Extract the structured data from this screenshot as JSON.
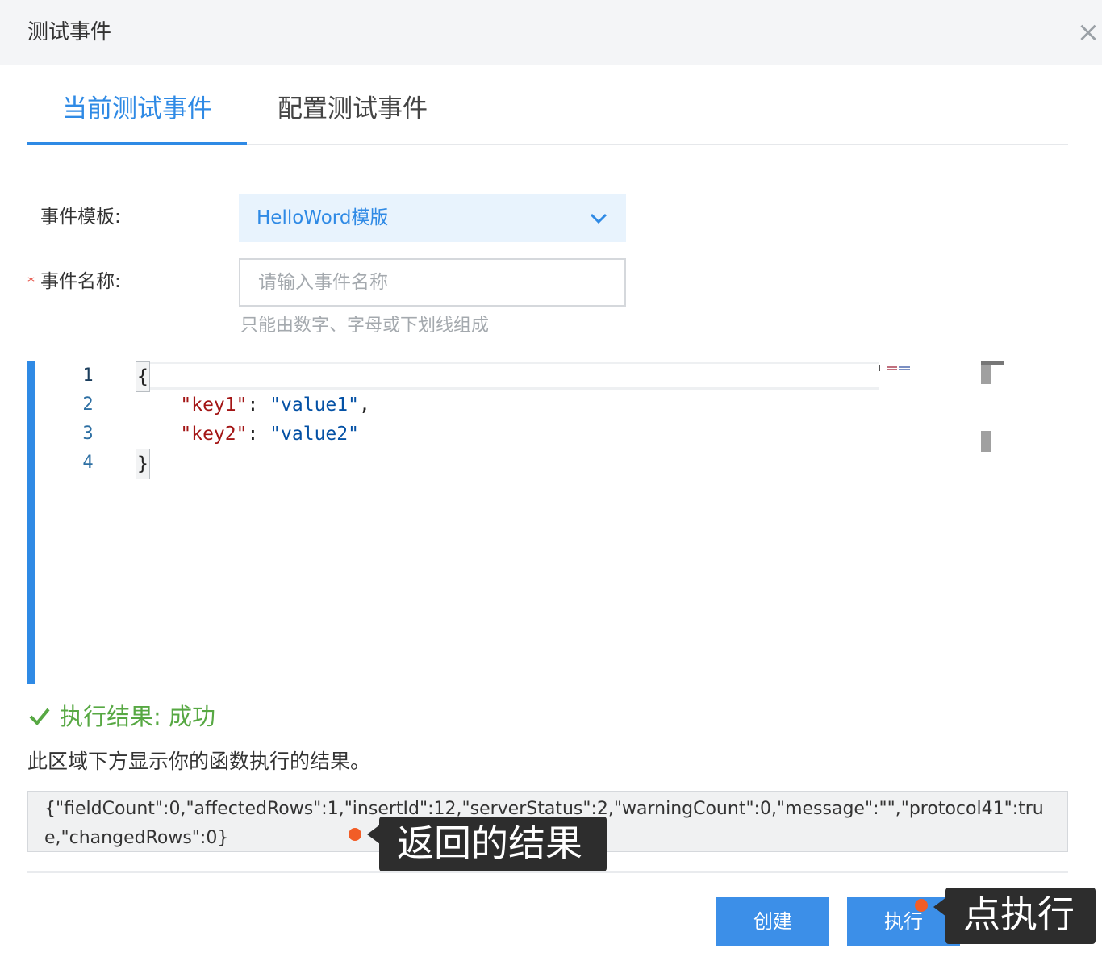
{
  "dialog": {
    "title": "测试事件",
    "close_glyph": "×"
  },
  "tabs": [
    {
      "label": "当前测试事件",
      "active": true
    },
    {
      "label": "配置测试事件",
      "active": false
    }
  ],
  "form": {
    "template_label": "事件模板:",
    "template_value": "HelloWord模版",
    "required_mark": "*",
    "name_label": "事件名称:",
    "name_placeholder": "请输入事件名称",
    "name_value": "",
    "name_hint": "只能由数字、字母或下划线组成"
  },
  "editor": {
    "line_numbers": [
      "1",
      "2",
      "3",
      "4"
    ],
    "lines": [
      {
        "text": "{"
      },
      {
        "indent": "    ",
        "key": "\"key1\"",
        "sep": ": ",
        "value": "\"value1\"",
        "tail": ","
      },
      {
        "indent": "    ",
        "key": "\"key2\"",
        "sep": ": ",
        "value": "\"value2\"",
        "tail": ""
      },
      {
        "text": "}"
      }
    ]
  },
  "result": {
    "status": "执行结果: 成功",
    "description": "此区域下方显示你的函数执行的结果。",
    "output": "{\"fieldCount\":0,\"affectedRows\":1,\"insertId\":12,\"serverStatus\":2,\"warningCount\":0,\"message\":\"\",\"protocol41\":true,\"changedRows\":0}"
  },
  "buttons": {
    "create": "创建",
    "run": "执行"
  },
  "annotations": {
    "result_callout": "返回的结果",
    "run_callout": "点执行"
  },
  "colors": {
    "accent": "#2f8ae5",
    "success": "#57a843",
    "button": "#3c8fe8",
    "callout_bg": "#2d2d2d",
    "marker": "#f25d27"
  }
}
